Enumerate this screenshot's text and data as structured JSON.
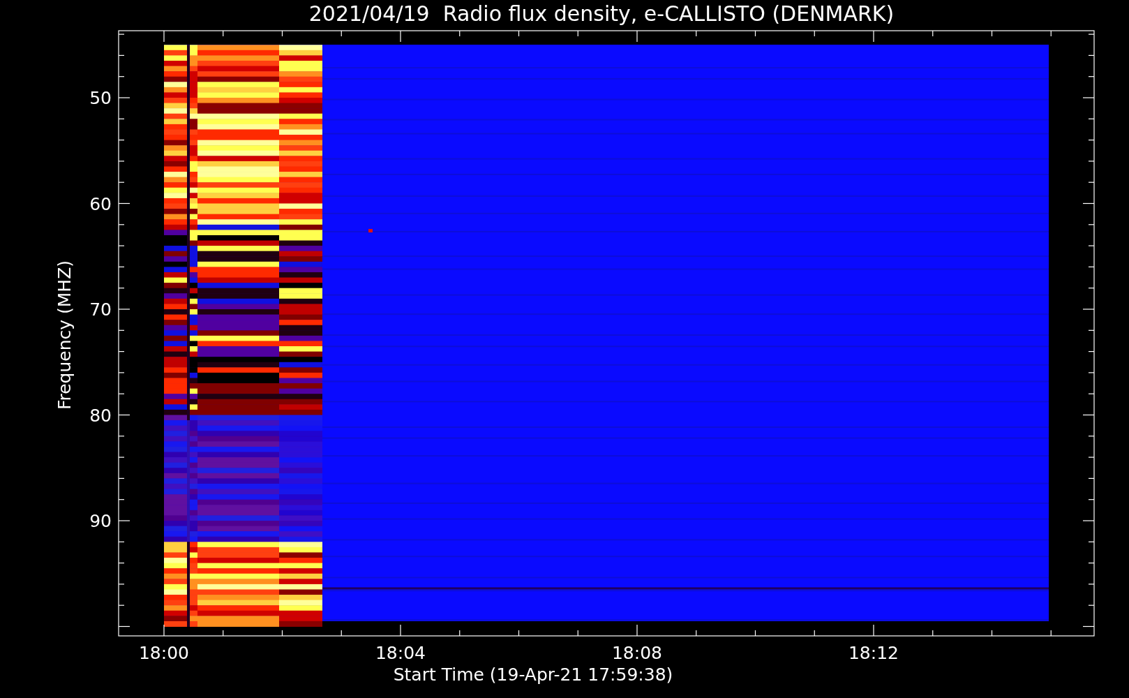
{
  "title": "2021/04/19  Radio flux density, e-CALLISTO (DENMARK)",
  "y_axis": {
    "label": "Frequency (MHZ)",
    "ticks": [
      "50",
      "60",
      "70",
      "80",
      "90"
    ]
  },
  "x_axis": {
    "label": "Start Time (19-Apr-21 17:59:38)",
    "ticks": [
      "18:00",
      "18:04",
      "18:08",
      "18:12"
    ]
  }
}
